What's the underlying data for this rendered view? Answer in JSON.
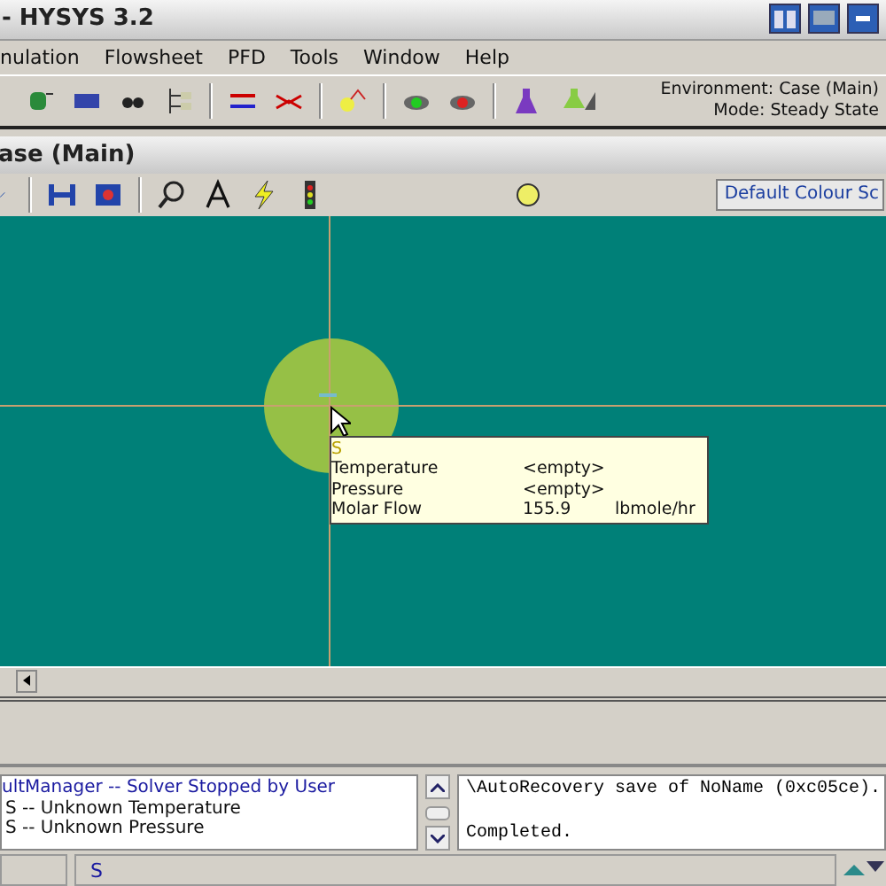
{
  "window": {
    "title": "- HYSYS 3.2"
  },
  "menu": [
    "nulation",
    "Flowsheet",
    "PFD",
    "Tools",
    "Window",
    "Help"
  ],
  "environment": [
    "Environment: Case (Main)",
    "Mode: Steady State"
  ],
  "case_window": {
    "title": "ase (Main)",
    "colour_scheme": "Default Colour Sc"
  },
  "tooltip": {
    "title": "S",
    "rows": [
      {
        "label": "Temperature",
        "value": "<empty>"
      },
      {
        "label": "Pressure",
        "value": "<empty>"
      },
      {
        "label": "Molar Flow",
        "value": "155.9",
        "unit": "lbmole/hr"
      }
    ]
  },
  "messages": [
    "ultManager -- Solver Stopped by User",
    "S -- Unknown Temperature",
    "S -- Unknown Pressure"
  ],
  "trace": [
    "\\AutoRecovery save of NoName (0xc05ce).",
    "Completed."
  ],
  "status": "S"
}
